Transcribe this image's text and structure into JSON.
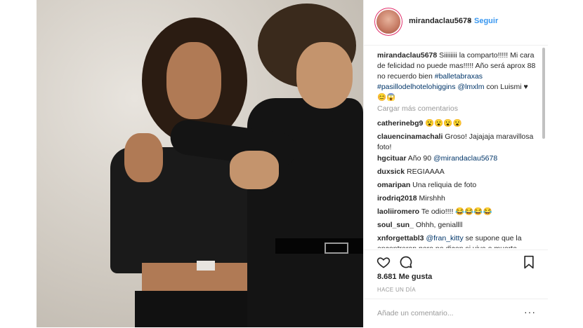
{
  "post": {
    "username": "mirandaclau5678",
    "separator": "•",
    "follow_label": "Seguir",
    "caption": {
      "author": "mirandaclau5678",
      "text": " Siiiiiiii la comparto!!!!! Mi cara de felicidad no puede mas!!!!! Año será aprox 88 no recuerdo bien ",
      "hashtag1": "#balletabraxas",
      "hashtag2": "#pasillodelhotelohiggins",
      "mention": "@lmxlm",
      "tail": " con Luismi ♥😊😱"
    },
    "load_more": "Cargar más comentarios",
    "comments": [
      {
        "user": "catherinebg9",
        "text": " 😮😮😮😮"
      },
      {
        "user": "clauencinamachali",
        "text": " Groso! Jajajaja maravillosa foto!"
      },
      {
        "user": "hgcituar",
        "text": " Año 90 ",
        "mention": "@mirandaclau5678"
      },
      {
        "user": "duxsick",
        "text": " REGIAAAA"
      },
      {
        "user": "omaripan",
        "text": " Una reliquia de foto"
      },
      {
        "user": "irodriq2018",
        "text": " Mirshhh"
      },
      {
        "user": "laoliiromero",
        "text": " Te odio!!!! 😂😂😂😂"
      },
      {
        "user": "soul_sun_",
        "text": " Ohhh, geniallll"
      },
      {
        "user": "xnforgettabl3",
        "mention": "@fran_kitty",
        "text": " se supone que la encontraron pero no dicen si viva o muerta"
      }
    ],
    "likes": "8.681 Me gusta",
    "time": "HACE UN DÍA",
    "add_comment_placeholder": "Añade un comentario...",
    "more_options": "···",
    "icons": {
      "like": "heart-icon",
      "comment": "comment-icon",
      "save": "bookmark-icon"
    },
    "colors": {
      "link": "#003569",
      "follow": "#3897f0",
      "border": "#efefef"
    }
  }
}
